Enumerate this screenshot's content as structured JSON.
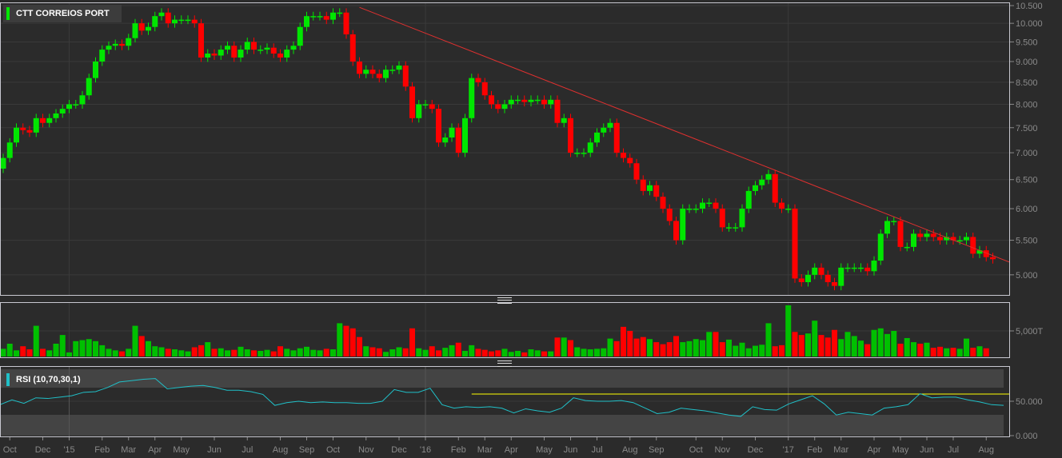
{
  "chart_data": {
    "type": "candlestick",
    "title": "CTT CORREIOS PORT",
    "scale": "log",
    "ylim": [
      4.75,
      10.6
    ],
    "price_ticks": [
      "10.500",
      "10.000",
      "9.500",
      "9.000",
      "8.500",
      "8.000",
      "7.500",
      "7.000",
      "6.500",
      "6.000",
      "5.500",
      "5.000"
    ],
    "price_tick_values": [
      10.5,
      10.0,
      9.5,
      9.0,
      8.5,
      8.0,
      7.5,
      7.0,
      6.5,
      6.0,
      5.5,
      5.0
    ],
    "colors": {
      "up": "#00e600",
      "down": "#ff0000",
      "trendline": "#e0302f",
      "rsi": "#20c0c8",
      "rsi_level": "#ffff00"
    },
    "first_open": 6.7,
    "close": [
      6.9,
      7.2,
      7.5,
      7.45,
      7.4,
      7.7,
      7.6,
      7.7,
      7.8,
      7.9,
      8.0,
      8.0,
      8.2,
      8.6,
      9.0,
      9.3,
      9.4,
      9.45,
      9.4,
      9.6,
      10.0,
      9.8,
      9.9,
      10.2,
      10.3,
      10.0,
      10.1,
      10.1,
      10.1,
      10.0,
      9.1,
      9.2,
      9.15,
      9.3,
      9.4,
      9.1,
      9.3,
      9.5,
      9.3,
      9.3,
      9.35,
      9.2,
      9.1,
      9.3,
      9.4,
      9.9,
      10.2,
      10.2,
      10.2,
      10.1,
      10.3,
      10.3,
      9.7,
      9.0,
      8.7,
      8.8,
      8.7,
      8.6,
      8.8,
      8.8,
      8.9,
      8.4,
      7.7,
      8.0,
      8.0,
      7.9,
      7.2,
      7.3,
      7.5,
      7.0,
      7.7,
      8.6,
      8.5,
      8.2,
      8.0,
      7.9,
      8.0,
      8.1,
      8.1,
      8.05,
      8.1,
      8.1,
      8.0,
      8.1,
      7.6,
      7.7,
      7.0,
      7.0,
      7.0,
      7.2,
      7.4,
      7.5,
      7.6,
      7.0,
      6.9,
      6.8,
      6.5,
      6.3,
      6.4,
      6.2,
      6.0,
      5.8,
      5.5,
      6.0,
      6.0,
      6.0,
      6.1,
      6.1,
      6.0,
      5.7,
      5.7,
      5.7,
      6.0,
      6.3,
      6.4,
      6.5,
      6.6,
      6.1,
      6.0,
      6.0,
      4.95,
      4.9,
      5.0,
      5.1,
      5.0,
      4.9,
      4.85,
      5.1,
      5.1,
      5.1,
      5.1,
      5.05,
      5.2,
      5.6,
      5.8,
      5.8,
      5.4,
      5.4,
      5.6,
      5.55,
      5.6,
      5.55,
      5.5,
      5.55,
      5.5,
      5.5,
      5.55,
      5.3,
      5.35,
      5.25,
      5.22
    ],
    "trendline": {
      "from_week": 54,
      "from_price": 10.45,
      "to_week": 153,
      "to_price": 5.18
    },
    "x_labels": [
      {
        "text": "Oct",
        "week": 1
      },
      {
        "text": "Dec",
        "week": 6
      },
      {
        "text": "'15",
        "week": 10
      },
      {
        "text": "Feb",
        "week": 15
      },
      {
        "text": "Mar",
        "week": 19
      },
      {
        "text": "Apr",
        "week": 23
      },
      {
        "text": "May",
        "week": 27
      },
      {
        "text": "Jun",
        "week": 32
      },
      {
        "text": "Jul",
        "week": 37
      },
      {
        "text": "Aug",
        "week": 42
      },
      {
        "text": "Sep",
        "week": 46
      },
      {
        "text": "Oct",
        "week": 50
      },
      {
        "text": "Nov",
        "week": 55
      },
      {
        "text": "Dec",
        "week": 60
      },
      {
        "text": "'16",
        "week": 64
      },
      {
        "text": "Feb",
        "week": 69
      },
      {
        "text": "Mar",
        "week": 73
      },
      {
        "text": "Apr",
        "week": 77
      },
      {
        "text": "May",
        "week": 82
      },
      {
        "text": "Jun",
        "week": 86
      },
      {
        "text": "Jul",
        "week": 90
      },
      {
        "text": "Aug",
        "week": 95
      },
      {
        "text": "Sep",
        "week": 99
      },
      {
        "text": "Oct",
        "week": 105
      },
      {
        "text": "Nov",
        "week": 109
      },
      {
        "text": "Dec",
        "week": 114
      },
      {
        "text": "'17",
        "week": 119
      },
      {
        "text": "Feb",
        "week": 123
      },
      {
        "text": "Mar",
        "week": 127
      },
      {
        "text": "Apr",
        "week": 132
      },
      {
        "text": "May",
        "week": 136
      },
      {
        "text": "Jun",
        "week": 140
      },
      {
        "text": "Jul",
        "week": 144
      },
      {
        "text": "Aug",
        "week": 149
      }
    ],
    "year_weeks": [
      10,
      64,
      119
    ],
    "volume": {
      "tick": "5,000T",
      "tick_value": 5000,
      "max": 10500,
      "values": [
        1500,
        2500,
        1200,
        2000,
        1400,
        6000,
        1500,
        1200,
        2500,
        4200,
        800,
        3000,
        3200,
        3400,
        3000,
        2200,
        1500,
        1200,
        1000,
        1500,
        6000,
        4000,
        3000,
        2000,
        1800,
        1500,
        1400,
        1200,
        1000,
        1800,
        2200,
        2800,
        1500,
        1600,
        1200,
        1300,
        1900,
        1400,
        1200,
        1100,
        1300,
        1000,
        2000,
        1500,
        1200,
        1600,
        1900,
        1300,
        1200,
        1500,
        1400,
        6500,
        6000,
        5500,
        3800,
        2000,
        1800,
        1600,
        900,
        1400,
        1800,
        1600,
        5500,
        1600,
        1300,
        2000,
        1200,
        1700,
        2200,
        2700,
        1100,
        2200,
        1500,
        1300,
        1000,
        1200,
        1500,
        900,
        1100,
        800,
        1400,
        1200,
        1000,
        1000,
        3700,
        3700,
        3200,
        1800,
        1500,
        1400,
        1500,
        1600,
        3500,
        3000,
        5800,
        5000,
        3500,
        3800,
        3400,
        2800,
        2400,
        2800,
        4000,
        2800,
        3000,
        3400,
        3200,
        4800,
        4800,
        2800,
        3300,
        2100,
        2700,
        1600,
        2100,
        2300,
        6500,
        2000,
        2200,
        10000,
        4800,
        4200,
        4500,
        7000,
        4200,
        3700,
        5200,
        3400,
        4800,
        4000,
        3100,
        2400,
        5200,
        5500,
        4400,
        5000,
        2500,
        3600,
        2800,
        2500,
        2700,
        1700,
        1900,
        1600,
        1700,
        1500,
        3500,
        1700,
        2000,
        1600
      ]
    },
    "rsi": {
      "label": "RSI (10,70,30,1)",
      "params": [
        10,
        70,
        30,
        1
      ],
      "upper": 70,
      "lower": 30,
      "level_line": 60.5,
      "level_from_week": 71,
      "ticks": [
        "50.000",
        "0.000"
      ],
      "tick_values": [
        50,
        0
      ],
      "values": [
        45,
        52,
        47,
        55,
        54,
        56,
        58,
        63,
        64,
        70,
        78,
        80,
        82,
        83,
        68,
        70,
        72,
        73,
        70,
        66,
        66,
        64,
        60,
        44,
        48,
        50,
        48,
        49,
        48,
        48,
        47,
        47,
        50,
        67,
        63,
        63,
        69,
        45,
        40,
        42,
        41,
        42,
        40,
        33,
        39,
        36,
        34,
        40,
        55,
        51,
        50,
        50,
        51,
        48,
        40,
        32,
        34,
        40,
        38,
        36,
        33,
        30,
        28,
        42,
        38,
        37,
        46,
        52,
        58,
        46,
        30,
        34,
        32,
        30,
        40,
        42,
        45,
        61,
        55,
        56,
        56,
        52,
        49,
        45,
        44
      ]
    }
  }
}
